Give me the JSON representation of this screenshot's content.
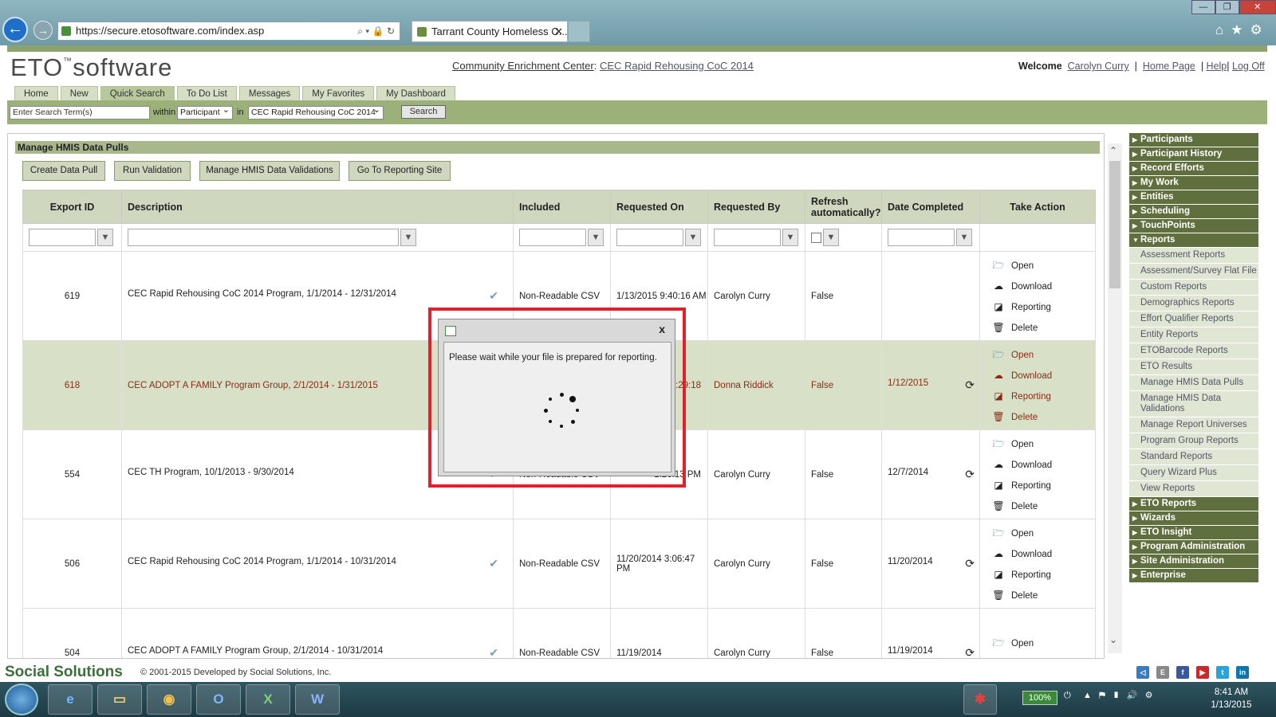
{
  "browser": {
    "url": "https://secure.etosoftware.com/index.asp",
    "tab_title": "Tarrant County Homeless C...",
    "window_controls": [
      "—",
      "❐",
      "✕"
    ]
  },
  "header": {
    "logo_text": "ETO",
    "logo_tm": "™",
    "logo_suffix": "software",
    "org_label": "Community Enrichment Center",
    "program_link": "CEC Rapid Rehousing CoC 2014",
    "welcome_label": "Welcome",
    "user_name": "Carolyn Curry",
    "home_page": "Home Page",
    "help": "Help",
    "log_off": "Log Off"
  },
  "nav_tabs": [
    "Home",
    "New",
    "Quick Search",
    "To Do List",
    "Messages",
    "My Favorites",
    "My Dashboard"
  ],
  "search": {
    "placeholder": "Enter Search Term(s)",
    "within_label": "within",
    "within_value": "Participant",
    "in_label": "in",
    "in_value": "CEC Rapid Rehousing CoC 2014",
    "button": "Search"
  },
  "section_title": "Manage HMIS Data Pulls",
  "actions": [
    "Create Data Pull",
    "Run Validation",
    "Manage HMIS Data Validations",
    "Go To Reporting Site"
  ],
  "table": {
    "headers": [
      "Export ID",
      "Description",
      "Included",
      "Requested On",
      "Requested By",
      "Refresh automatically?",
      "Date Completed",
      "Take Action"
    ],
    "rows": [
      {
        "id": "619",
        "description": "CEC Rapid Rehousing CoC 2014 Program, 1/1/2014 - 12/31/2014",
        "included": "Non-Readable CSV",
        "requested_on": "1/13/2015 9:40:16 AM",
        "requested_by": "Carolyn Curry",
        "refresh": "False",
        "completed": ""
      },
      {
        "id": "618",
        "description": "CEC ADOPT A FAMILY Program Group, 2/1/2014 - 1/31/2015",
        "included": "",
        "requested_on": "3:29:18",
        "requested_by": "Donna Riddick",
        "refresh": "False",
        "completed": "1/12/2015"
      },
      {
        "id": "554",
        "description": "CEC TH Program, 10/1/2013 - 9/30/2014",
        "included": "Non-Readable CSV",
        "requested_on": "1:26:13 PM",
        "requested_by": "Carolyn Curry",
        "refresh": "False",
        "completed": "12/7/2014"
      },
      {
        "id": "506",
        "description": "CEC Rapid Rehousing CoC 2014 Program, 1/1/2014 - 10/31/2014",
        "included": "Non-Readable CSV",
        "requested_on": "11/20/2014 3:06:47 PM",
        "requested_by": "Carolyn Curry",
        "refresh": "False",
        "completed": "11/20/2014"
      },
      {
        "id": "504",
        "description": "CEC ADOPT A FAMILY Program Group, 2/1/2014 - 10/31/2014",
        "included": "Non-Readable CSV",
        "requested_on": "11/19/2014",
        "requested_by": "Carolyn Curry",
        "refresh": "False",
        "completed": "11/19/2014"
      }
    ],
    "row_actions": [
      "Open",
      "Download",
      "Reporting",
      "Delete"
    ]
  },
  "sidemenu": {
    "top": [
      "Participants",
      "Participant History",
      "Record Efforts",
      "My Work",
      "Entities",
      "Scheduling",
      "TouchPoints"
    ],
    "open_section": "Reports",
    "reports_items": [
      "Assessment Reports",
      "Assessment/Survey Flat File",
      "Custom Reports",
      "Demographics Reports",
      "Effort Qualifier Reports",
      "Entity Reports",
      "ETOBarcode Reports",
      "ETO Results",
      "Manage HMIS Data Pulls",
      "Manage HMIS Data Validations",
      "Manage Report Universes",
      "Program Group Reports",
      "Standard Reports",
      "Query Wizard Plus",
      "View Reports"
    ],
    "bottom": [
      "ETO Reports",
      "Wizards",
      "ETO Insight",
      "Program Administration",
      "Site Administration",
      "Enterprise"
    ]
  },
  "dialog": {
    "message": "Please wait while your file is prepared for reporting.",
    "close": "x"
  },
  "footer": {
    "brand": "Social Solutions",
    "copyright": "© 2001-2015 Developed by Social Solutions, Inc."
  },
  "taskbar": {
    "battery": "100%",
    "time": "8:41 AM",
    "date": "1/13/2015"
  }
}
